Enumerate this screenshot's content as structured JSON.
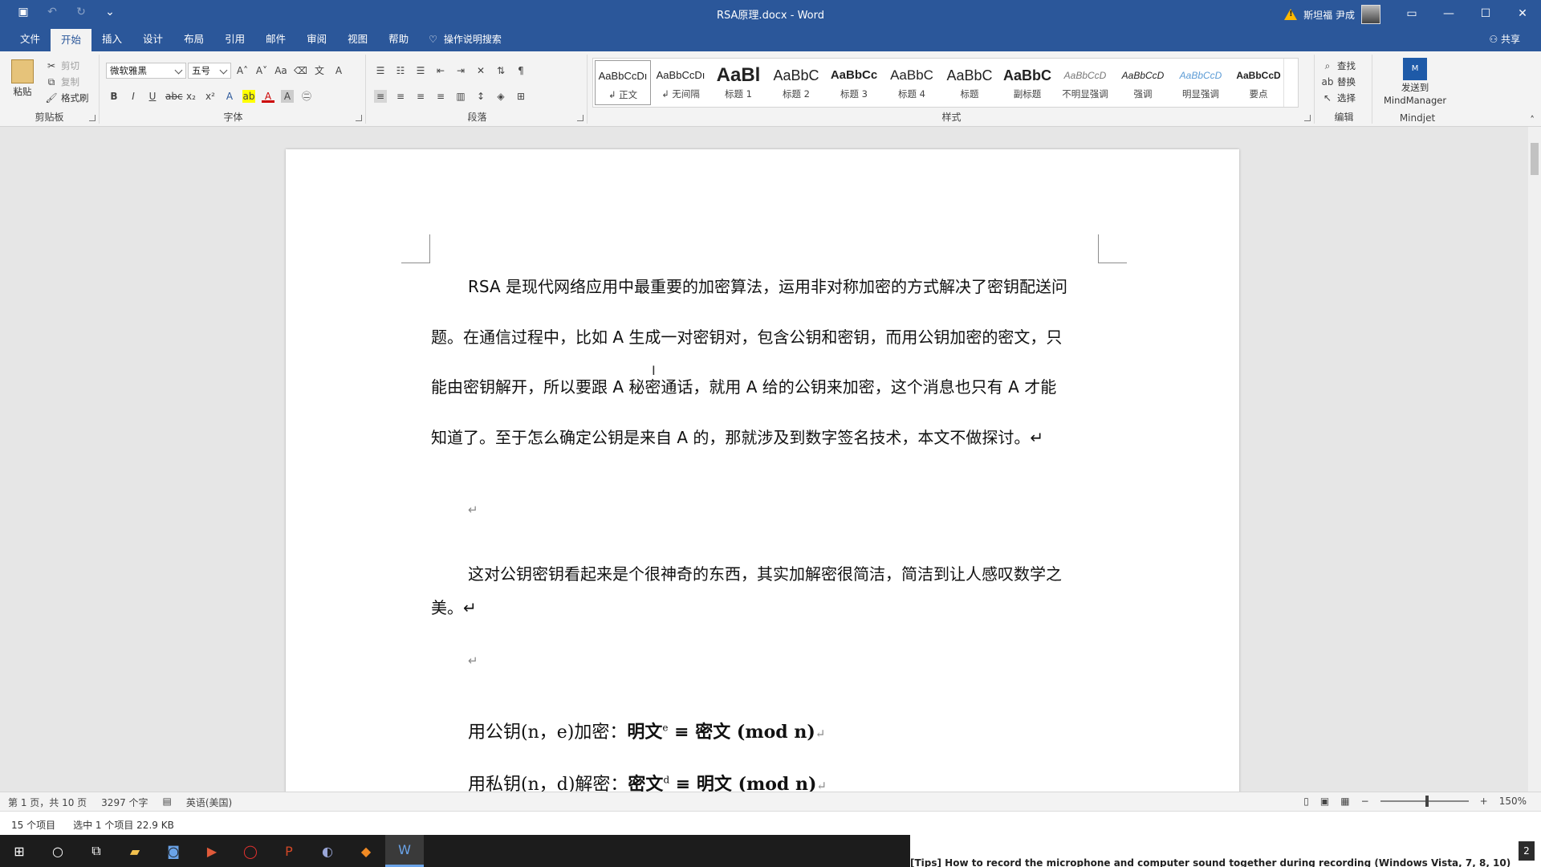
{
  "titlebar": {
    "title": "RSA原理.docx  -  Word",
    "user_name": "斯坦福 尹成",
    "icons": [
      "save-icon",
      "undo-icon",
      "redo-icon",
      "customize-icon"
    ]
  },
  "menu": {
    "tabs": [
      "文件",
      "开始",
      "插入",
      "设计",
      "布局",
      "引用",
      "邮件",
      "审阅",
      "视图",
      "帮助"
    ],
    "active_tab": "开始",
    "tell_me": "操作说明搜索",
    "share": "共享"
  },
  "ribbon": {
    "clipboard": {
      "paste": "粘贴",
      "cut": "剪切",
      "copy": "复制",
      "format_painter": "格式刷",
      "label": "剪贴板"
    },
    "font": {
      "font_name": "微软雅黑",
      "font_size": "五号",
      "label": "字体"
    },
    "paragraph": {
      "label": "段落"
    },
    "styles": {
      "label": "样式",
      "items": [
        {
          "preview": "AaBbCcDı",
          "name": "↲ 正文"
        },
        {
          "preview": "AaBbCcDı",
          "name": "↲ 无间隔"
        },
        {
          "preview": "AaBl",
          "name": "标题 1"
        },
        {
          "preview": "AaBbC",
          "name": "标题 2"
        },
        {
          "preview": "AaBbCc",
          "name": "标题 3"
        },
        {
          "preview": "AaBbC",
          "name": "标题 4"
        },
        {
          "preview": "AaBbC",
          "name": "标题"
        },
        {
          "preview": "AaBbC",
          "name": "副标题"
        },
        {
          "preview": "AaBbCcD",
          "name": "不明显强调"
        },
        {
          "preview": "AaBbCcD",
          "name": "强调"
        },
        {
          "preview": "AaBbCcD",
          "name": "明显强调"
        },
        {
          "preview": "AaBbCcD",
          "name": "要点"
        }
      ]
    },
    "editing": {
      "find": "查找",
      "replace": "替换",
      "select": "选择",
      "label": "编辑"
    },
    "mindjet": {
      "send_line1": "发送到",
      "send_line2": "MindManager",
      "label": "Mindjet"
    }
  },
  "document": {
    "para1_lines": [
      "RSA 是现代网络应用中最重要的加密算法，运用非对称加密的方式解决了密钥配送问",
      "题。在通信过程中，比如 A 生成一对密钥对，包含公钥和密钥，而用公钥加密的密文，只",
      "能由密钥解开，所以要跟 A 秘密通话，就用 A 给的公钥来加密，这个消息也只有 A 才能",
      "知道了。至于怎么确定公钥是来自 A 的，那就涉及到数字签名技术，本文不做探讨。↵"
    ],
    "empty_mark": "↵",
    "para2_lines": [
      "这对公钥密钥看起来是个很神奇的东西，其实加解密很简洁，简洁到让人感叹数学之",
      "美。↵"
    ],
    "eq1": {
      "prefix": "用公钥(n，e)加密：",
      "lhs": "明文",
      "exp": "e",
      "op": " ≡ ",
      "rhs": "密文",
      "mod": " (mod n)",
      "end": "↵"
    },
    "eq2": {
      "prefix": "用私钥(n，d)解密：",
      "lhs": "密文",
      "exp": "d",
      "op": " ≡ ",
      "rhs": "明文",
      "mod": " (mod n)",
      "end": "↵"
    }
  },
  "statusbar": {
    "page": "第 1 页，共 10 页",
    "words": "3297 个字",
    "language": "英语(美国)",
    "zoom": "150%",
    "zoom_level_percent": 150
  },
  "explorer": {
    "items_count": "15 个项目",
    "selected": "选中 1 个项目  22.9 KB"
  },
  "taskbar": {
    "apps": [
      "windows-start-icon",
      "search-circle-icon",
      "task-view-icon",
      "file-explorer-icon",
      "camera-app-icon",
      "video-editor-icon",
      "opera-icon",
      "powerpoint-icon",
      "media-app-icon",
      "app-orange-icon",
      "word-icon"
    ],
    "background_text": "[Tips] How to record the microphone and computer sound together during recording (Windows Vista, 7, 8, 10)",
    "badge": "2"
  },
  "colors": {
    "word_blue": "#2b579a",
    "ribbon_bg": "#f3f3f3",
    "taskbar": "#1c1c1c"
  }
}
